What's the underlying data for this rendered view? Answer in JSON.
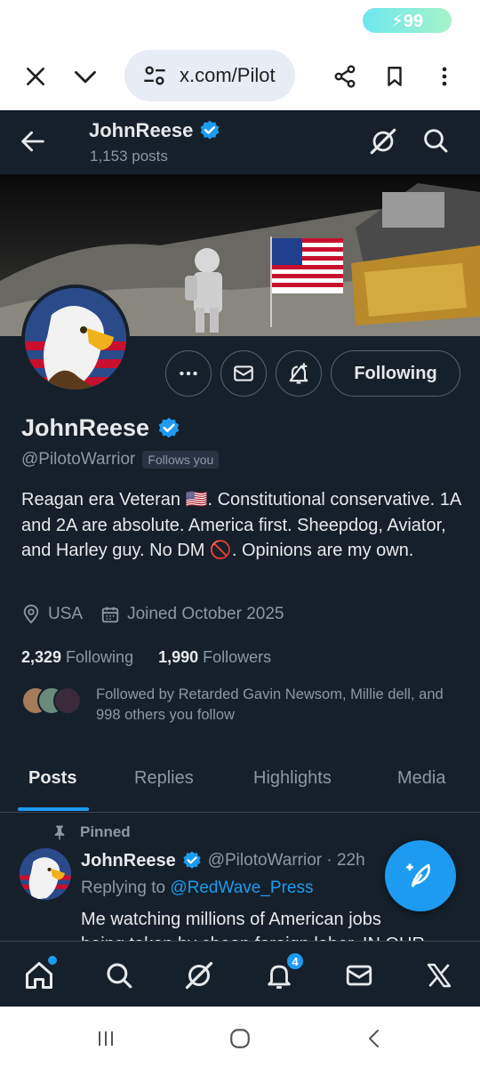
{
  "status_bar": {
    "battery_label": "⚡99"
  },
  "browser": {
    "close_label": "close",
    "url": "x.com/Pilot",
    "share_label": "share",
    "bookmark_label": "bookmark",
    "menu_label": "more"
  },
  "header": {
    "name": "JohnReese",
    "posts_count": "1,153 posts"
  },
  "profile": {
    "buttons": {
      "following_label": "Following"
    },
    "display_name": "JohnReese",
    "handle": "@PilotoWarrior",
    "follows_you": "Follows you",
    "bio": "Reagan era Veteran 🇺🇸. Constitutional conservative. 1A and 2A are absolute. America first. Sheepdog, Aviator, and Harley guy. No DM 🚫. Opinions are my own.",
    "location": "USA",
    "joined": "Joined October 2025",
    "following_count": "2,329",
    "following_label": "Following",
    "followers_count": "1,990",
    "followers_label": "Followers",
    "followed_by": "Followed by Retarded Gavin Newsom, Millie dell, and 998 others you follow"
  },
  "tabs": [
    "Posts",
    "Replies",
    "Highlights",
    "Media"
  ],
  "pinned_post": {
    "pinned_label": "Pinned",
    "author": "JohnReese",
    "handle_time": "@PilotoWarrior · 22h",
    "replying_prefix": "Replying to",
    "replying_to": "@RedWave_Press",
    "text": "Me watching millions of American jobs",
    "text_cut": "being taken by cheap foreign labor. IN OUR"
  },
  "bottom_nav": {
    "notifications_badge": "4"
  },
  "colors": {
    "background": "#15202b",
    "accent": "#1d9bf0",
    "muted": "#8b98a5"
  },
  "icons": [
    "back-arrow-icon",
    "grok-icon",
    "search-icon",
    "more-icon",
    "mail-icon",
    "bell-plus-icon",
    "verified-badge-icon",
    "location-icon",
    "calendar-icon",
    "pin-icon",
    "compose-icon",
    "home-icon",
    "bell-icon",
    "x-logo-icon"
  ]
}
